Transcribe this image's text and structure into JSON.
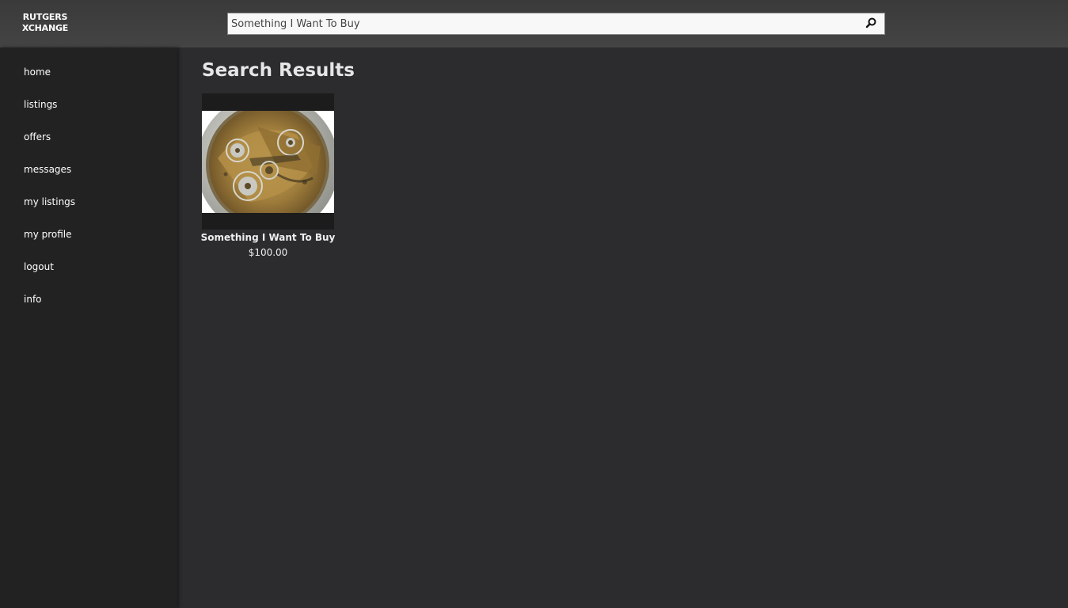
{
  "header": {
    "logo_line1": "RUTGERS",
    "logo_line2": "XCHANGE",
    "search": {
      "value": "Something I Want To Buy",
      "button_icon": "search-icon"
    }
  },
  "sidebar": {
    "items": [
      {
        "label": "home"
      },
      {
        "label": "listings"
      },
      {
        "label": "offers"
      },
      {
        "label": "messages"
      },
      {
        "label": "my listings"
      },
      {
        "label": "my profile"
      },
      {
        "label": "logout"
      },
      {
        "label": "info"
      }
    ]
  },
  "main": {
    "title": "Search Results",
    "results": [
      {
        "title": "Something I Want To Buy",
        "price": "$100.00",
        "image": "pocket-watch-movement-photo"
      }
    ]
  },
  "colors": {
    "topbar": "#444444",
    "sidebar": "#222222",
    "main_bg": "#2c2c2f",
    "card_bg": "#1c1c1c",
    "text": "#ffffff"
  }
}
